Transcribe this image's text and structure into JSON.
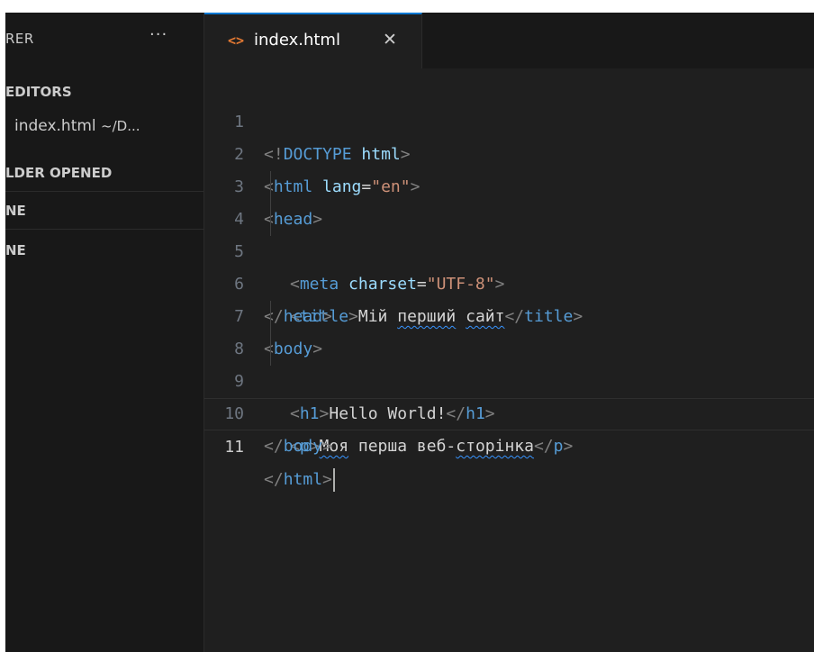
{
  "sidebar": {
    "title": "RER",
    "more": "···",
    "sections": {
      "open_editors": "EDITORS",
      "file_name": "index.html",
      "file_path": "~/D...",
      "no_folder": "LDER OPENED",
      "outline": "NE",
      "timeline": "NE"
    }
  },
  "tab": {
    "icon": "<>",
    "label": "index.html",
    "close": "✕"
  },
  "editor": {
    "line_numbers": [
      "1",
      "2",
      "3",
      "4",
      "5",
      "6",
      "7",
      "8",
      "9",
      "10",
      "11"
    ],
    "tokens": {
      "doctype_open": "<!",
      "doctype_kw": "DOCTYPE",
      "doctype_html": "html",
      "lt": "<",
      "gt": ">",
      "lt_slash": "</",
      "html": "html",
      "lang_attr": "lang",
      "eq": "=",
      "lang_val": "\"en\"",
      "head": "head",
      "meta": "meta",
      "charset_attr": "charset",
      "charset_val": "\"UTF-8\"",
      "title": "title",
      "title_text_1": "Мій ",
      "title_text_2": "перший",
      "title_text_3": " ",
      "title_text_4": "сайт",
      "body": "body",
      "h1": "h1",
      "h1_text": "Hello World!",
      "p": "p",
      "p_text_1": "Моя",
      "p_text_2": " перша веб-",
      "p_text_3": "сторінка"
    }
  },
  "colors": {
    "background": "#1f1f1f",
    "sidebar": "#181818",
    "accent": "#0078d4",
    "tag": "#569cd6",
    "attribute": "#9cdcfe",
    "string": "#ce9178",
    "text": "#d4d4d4",
    "html_icon": "#e37933"
  }
}
